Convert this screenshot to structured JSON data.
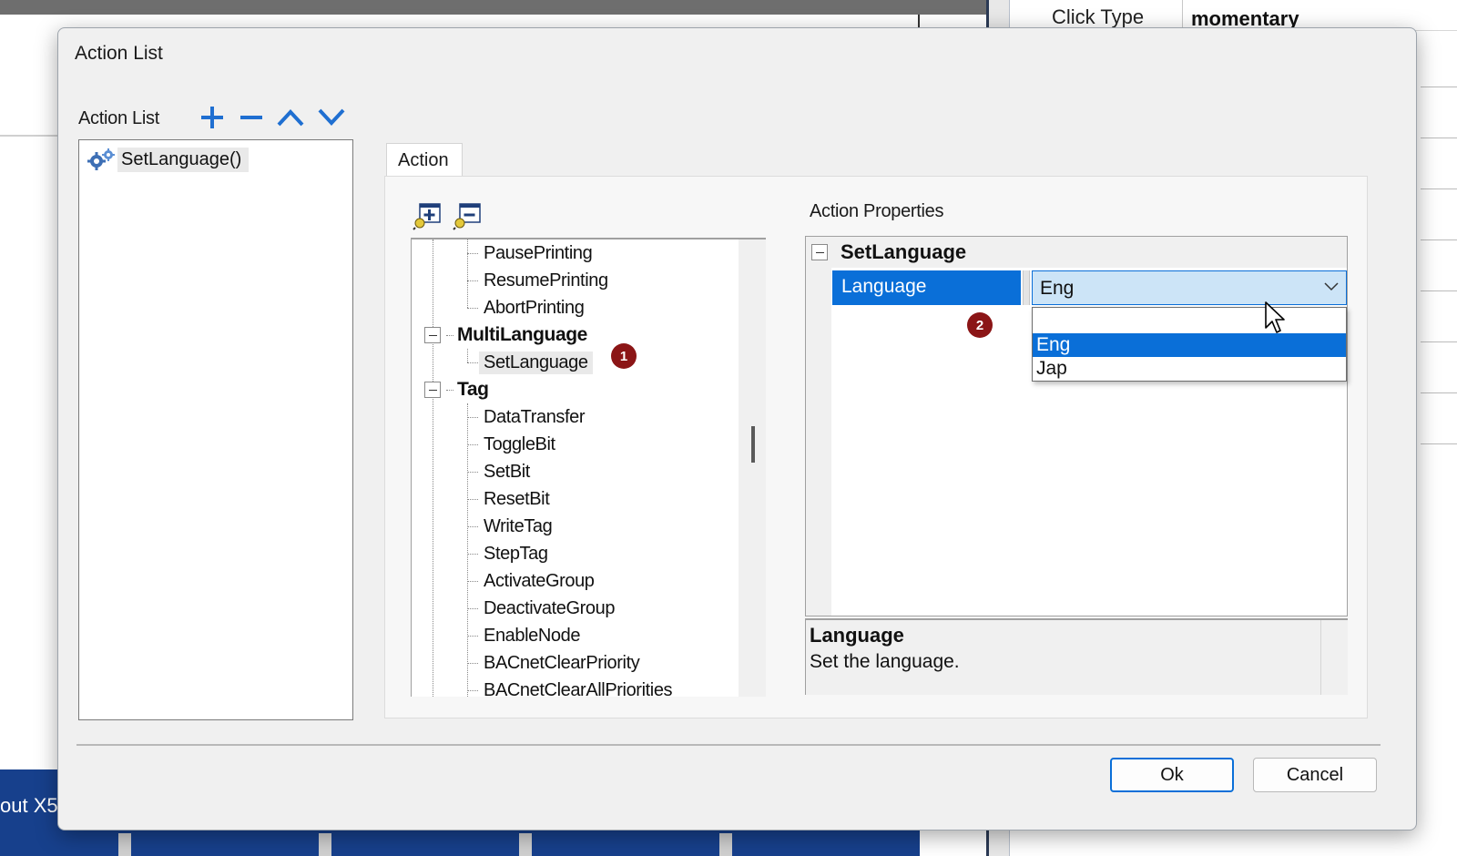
{
  "background": {
    "property_name": "Click Type",
    "property_value": "momentary",
    "bottom_text": "out X5"
  },
  "dialog": {
    "title": "Action List",
    "action_list_label": "Action List",
    "toolbar": {
      "add_icon": "plus-icon",
      "remove_icon": "minus-icon",
      "move_up_icon": "chevron-up-icon",
      "move_down_icon": "chevron-down-icon"
    },
    "action_list_items": [
      {
        "label": "SetLanguage()",
        "icon": "gear-icon"
      }
    ],
    "tab_label": "Action",
    "tree_toolbar": {
      "expand_icon": "expand-all-icon",
      "collapse_icon": "collapse-all-icon"
    },
    "tree": {
      "printing_leaves": [
        "PausePrinting",
        "ResumePrinting",
        "AbortPrinting"
      ],
      "group_multilanguage": "MultiLanguage",
      "multilanguage_leaves": [
        "SetLanguage"
      ],
      "group_tag": "Tag",
      "tag_leaves": [
        "DataTransfer",
        "ToggleBit",
        "SetBit",
        "ResetBit",
        "WriteTag",
        "StepTag",
        "ActivateGroup",
        "DeactivateGroup",
        "EnableNode",
        "BACnetClearPriority",
        "BACnetClearAllPriorities"
      ]
    },
    "badges": [
      "1",
      "2"
    ],
    "properties": {
      "label": "Action Properties",
      "category": "SetLanguage",
      "property_name": "Language",
      "property_value": "Eng",
      "dropdown_options": [
        "",
        "Eng",
        "Jap"
      ],
      "selected_option": "Eng"
    },
    "description": {
      "title": "Language",
      "text": "Set the language."
    },
    "buttons": {
      "ok": "Ok",
      "cancel": "Cancel"
    },
    "colors": {
      "accent": "#0a6fd8",
      "badge": "#8b1516",
      "toolbar_icon": "#1f6fd1"
    }
  }
}
